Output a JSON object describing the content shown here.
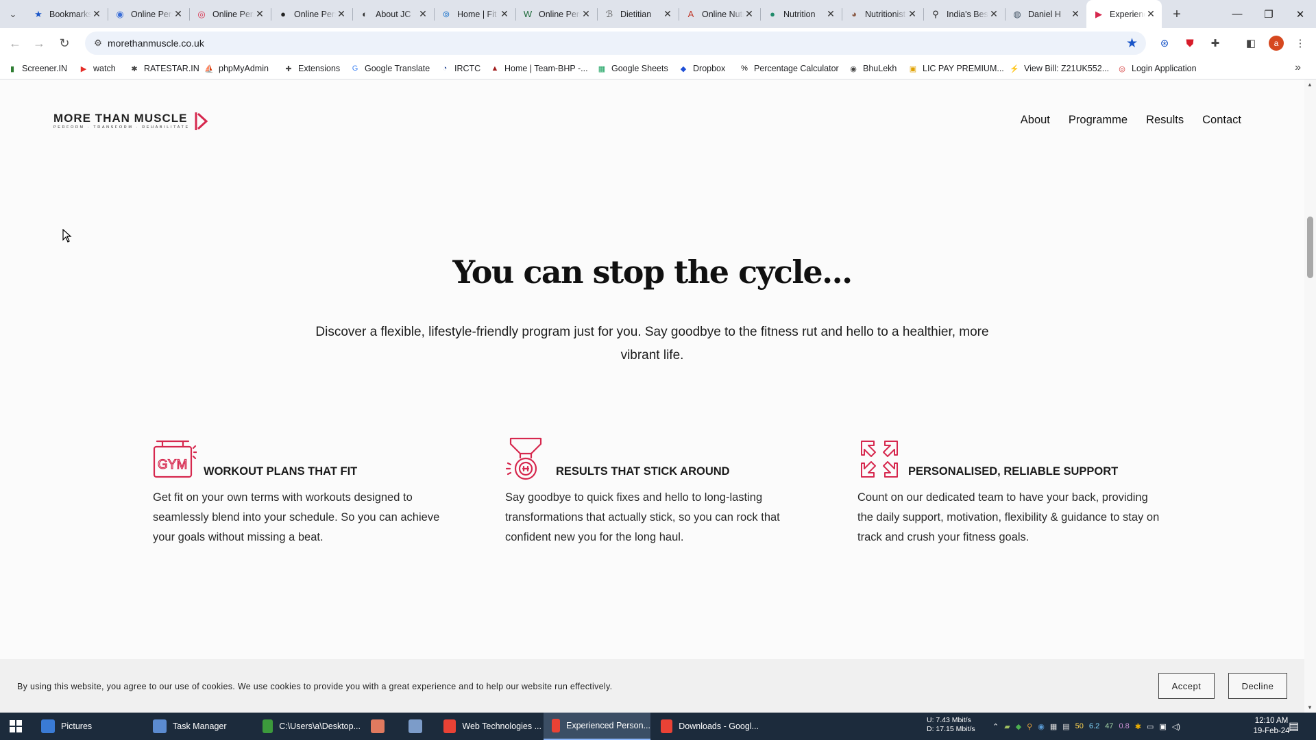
{
  "browser": {
    "tabs": [
      {
        "title": "Bookmarks",
        "icon": "star-icon",
        "color": "#1a56c8",
        "glyph": "★"
      },
      {
        "title": "Online Pers",
        "icon": "globe-icon",
        "color": "#3b6fd8",
        "glyph": "◉"
      },
      {
        "title": "Online Pers",
        "icon": "ring-icon",
        "color": "#d9304b",
        "glyph": "◎"
      },
      {
        "title": "Online Pers",
        "icon": "circle-icon",
        "color": "#222222",
        "glyph": "●"
      },
      {
        "title": "About JC",
        "icon": "person-icon",
        "color": "#333333",
        "glyph": "◐"
      },
      {
        "title": "Home | Fit",
        "icon": "shield-icon",
        "color": "#2f7fcf",
        "glyph": "⊚"
      },
      {
        "title": "Online Pers",
        "icon": "w-logo-icon",
        "color": "#1e6b3a",
        "glyph": "W"
      },
      {
        "title": "Dietitian",
        "icon": "script-icon",
        "color": "#555555",
        "glyph": "ℬ"
      },
      {
        "title": "Online Nutr",
        "icon": "letter-a-icon",
        "color": "#c0392b",
        "glyph": "A"
      },
      {
        "title": "Nutrition",
        "icon": "leaf-icon",
        "color": "#1f8a6a",
        "glyph": "●"
      },
      {
        "title": "Nutritionist",
        "icon": "portrait-icon",
        "color": "#8a5a44",
        "glyph": "◕"
      },
      {
        "title": "India's Best",
        "icon": "map-pin-icon",
        "color": "#222222",
        "glyph": "⚲"
      },
      {
        "title": "Daniel H",
        "icon": "globe-icon",
        "color": "#445566",
        "glyph": "◍"
      },
      {
        "title": "Experienced",
        "icon": "mtm-logo-icon",
        "color": "#d6284e",
        "glyph": "▶",
        "active": true
      }
    ],
    "new_tab_label": "+",
    "url": "morethanmuscle.co.uk",
    "profile_initial": "a",
    "bookmarks": [
      {
        "label": "Screener.IN",
        "icon": "bar-chart-icon",
        "color": "#2e7d32",
        "glyph": "▮"
      },
      {
        "label": "watch",
        "icon": "youtube-icon",
        "color": "#e52d27",
        "glyph": "▶"
      },
      {
        "label": "RATESTAR.IN",
        "icon": "ratestar-icon",
        "color": "#444444",
        "glyph": "✱"
      },
      {
        "label": "phpMyAdmin",
        "icon": "phpmyadmin-icon",
        "color": "#f29111",
        "glyph": "⛵"
      },
      {
        "label": "Extensions",
        "icon": "puzzle-icon",
        "color": "#444444",
        "glyph": "✚"
      },
      {
        "label": "Google Translate",
        "icon": "translate-icon",
        "color": "#4285f4",
        "glyph": "G"
      },
      {
        "label": "IRCTC",
        "icon": "irctc-icon",
        "color": "#1a3d8f",
        "glyph": "◔"
      },
      {
        "label": "Home | Team-BHP -...",
        "icon": "teambhp-icon",
        "color": "#a11d1d",
        "glyph": "▲"
      },
      {
        "label": "Google Sheets",
        "icon": "sheets-icon",
        "color": "#0f9d58",
        "glyph": "▦"
      },
      {
        "label": "Dropbox",
        "icon": "dropbox-icon",
        "color": "#1e4fd6",
        "glyph": "◆"
      },
      {
        "label": "Percentage Calculator",
        "icon": "percent-icon",
        "color": "#111111",
        "glyph": "%"
      },
      {
        "label": "BhuLekh",
        "icon": "bhulekh-icon",
        "color": "#444444",
        "glyph": "◉"
      },
      {
        "label": "LIC PAY PREMIUM...",
        "icon": "lic-icon",
        "color": "#e0a100",
        "glyph": "▣"
      },
      {
        "label": "View Bill: Z21UK552...",
        "icon": "bill-icon",
        "color": "#2a62c9",
        "glyph": "⚡"
      },
      {
        "label": "Login Application",
        "icon": "login-icon",
        "color": "#d32f2f",
        "glyph": "◎"
      }
    ]
  },
  "site": {
    "logo_text": "MORE THAN MUSCLE",
    "logo_tagline": "PERFORM · TRANSFORM · REHABILITATE",
    "brand_color": "#d6284e",
    "nav": [
      "About",
      "Programme",
      "Results",
      "Contact"
    ],
    "hero_title": "You can stop the cycle...",
    "hero_subtitle": "Discover a flexible, lifestyle-friendly program just for you. Say goodbye to the fitness rut and hello to a healthier, more vibrant life.",
    "features": [
      {
        "icon": "gym-sign-icon",
        "title": "WORKOUT PLANS THAT FIT",
        "text": "Get fit on your own terms with workouts designed to seamlessly blend into your schedule. So you can achieve your goals without missing a beat."
      },
      {
        "icon": "medal-icon",
        "title": "RESULTS THAT STICK AROUND",
        "text": "Say goodbye to quick fixes and hello to long-lasting transformations that actually stick, so you can rock that confident new you for the long haul."
      },
      {
        "icon": "arrows-support-icon",
        "title": "PERSONALISED, RELIABLE SUPPORT",
        "text": "Count on our dedicated team to have your back, providing the daily support, motivation, flexibility & guidance to stay on track and crush your fitness goals."
      }
    ],
    "cookie": {
      "text": "By using this website, you agree to our use of cookies. We use cookies to provide you with a great experience and to help our website run effectively.",
      "accept": "Accept",
      "decline": "Decline"
    }
  },
  "taskbar": {
    "items": [
      {
        "label": "Pictures",
        "icon": "pictures-icon",
        "color": "#3a7bd5"
      },
      {
        "label": "Task Manager",
        "icon": "task-manager-icon",
        "color": "#5b8bd0"
      },
      {
        "label": "C:\\Users\\a\\Desktop...",
        "icon": "notepad-icon",
        "color": "#3c9a3c"
      },
      {
        "label": "",
        "icon": "app-icon",
        "color": "#e07a5f"
      },
      {
        "label": "",
        "icon": "document-icon",
        "color": "#7c9cc9"
      },
      {
        "label": "Web Technologies ...",
        "icon": "chrome-icon",
        "color": "#e94235"
      },
      {
        "label": "Experienced Person...",
        "icon": "chrome-icon",
        "color": "#e94235",
        "active": true
      },
      {
        "label": "Downloads - Googl...",
        "icon": "chrome-icon",
        "color": "#e94235"
      }
    ],
    "network": {
      "up": "U:      7.43 Mbit/s",
      "down": "D:    17.15 Mbit/s"
    },
    "tray_numbers": [
      "50",
      "6.2",
      "47",
      "0.8"
    ],
    "time": "12:10 AM",
    "date": "19-Feb-24"
  }
}
